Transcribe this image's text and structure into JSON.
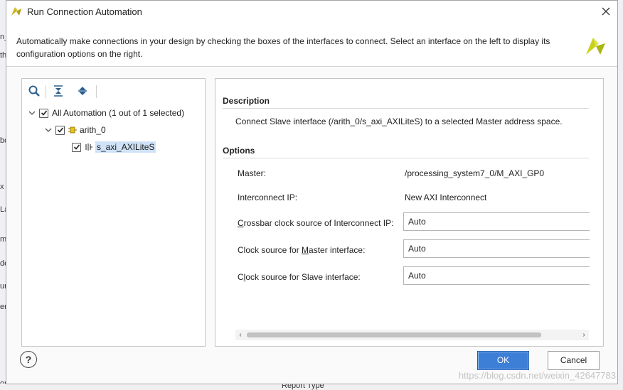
{
  "window": {
    "title": "Run Connection Automation"
  },
  "header": {
    "text": "Automatically make connections in your design by checking the boxes of the interfaces to connect. Select an interface on the left to display its configuration options on the right."
  },
  "tree": {
    "root_label": "All Automation (1 out of 1 selected)",
    "root_checked": true,
    "child_label": "arith_0",
    "child_checked": true,
    "leaf_label": "s_axi_AXILiteS",
    "leaf_checked": true
  },
  "description": {
    "heading": "Description",
    "text": "Connect Slave interface (/arith_0/s_axi_AXILiteS) to a selected Master address space."
  },
  "options": {
    "heading": "Options",
    "master_label": "Master:",
    "master_value": "/processing_system7_0/M_AXI_GP0",
    "interconnect_label": "Interconnect IP:",
    "interconnect_value": "New AXI Interconnect",
    "crossbar_label_pre": "",
    "crossbar_label_key": "C",
    "crossbar_label_post": "rossbar clock source of Interconnect IP:",
    "crossbar_value": "Auto",
    "master_clock_label_pre": "Clock source for ",
    "master_clock_label_key": "M",
    "master_clock_label_post": "aster interface:",
    "master_clock_value": "Auto",
    "slave_clock_label_pre": "C",
    "slave_clock_label_key": "l",
    "slave_clock_label_post": "ock source for Slave interface:",
    "slave_clock_value": "Auto"
  },
  "buttons": {
    "help": "?",
    "ok": "OK",
    "cancel": "Cancel"
  },
  "background": {
    "bottom_text": "Report Type",
    "left_fragments": [
      "n_",
      "th",
      "bo",
      "x",
      "La",
      "m",
      "de",
      "ur",
      "er",
      "or"
    ]
  },
  "watermark": "https://blog.csdn.net/weixin_42647783",
  "colors": {
    "accent": "#3d7ed6",
    "selection": "#cfe2f7",
    "logo": "#c9d11c"
  }
}
